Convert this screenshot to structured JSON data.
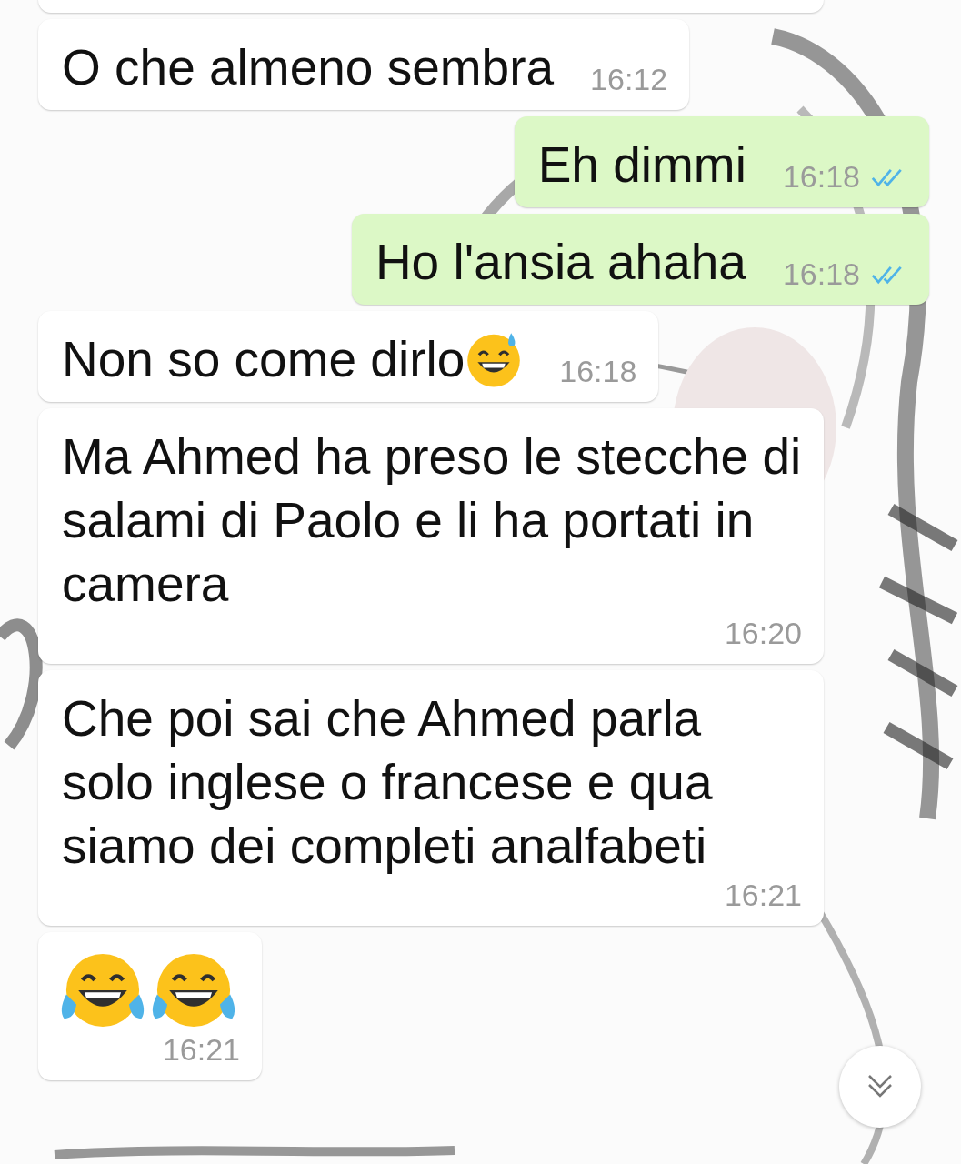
{
  "messages": [
    {
      "outgoing": false,
      "text": "O che almeno sembra",
      "time": "16:12"
    },
    {
      "outgoing": true,
      "text": "Eh dimmi",
      "time": "16:18",
      "read": true
    },
    {
      "outgoing": true,
      "text": "Ho l'ansia ahaha",
      "time": "16:18",
      "read": true
    },
    {
      "outgoing": false,
      "text": "Non so come dirlo",
      "emoji": [
        {
          "kind": "sweat"
        }
      ],
      "time": "16:18"
    },
    {
      "outgoing": false,
      "text": "Ma Ahmed ha preso le stecche di salami di Paolo e li ha portati in camera",
      "time": "16:20"
    },
    {
      "outgoing": false,
      "text": "Che poi sai che Ahmed parla solo inglese o francese e qua siamo dei completi analfabeti",
      "time": "16:21"
    },
    {
      "outgoing": false,
      "emoji": [
        {
          "kind": "joy"
        },
        {
          "kind": "joy"
        }
      ],
      "time": "16:21"
    }
  ]
}
